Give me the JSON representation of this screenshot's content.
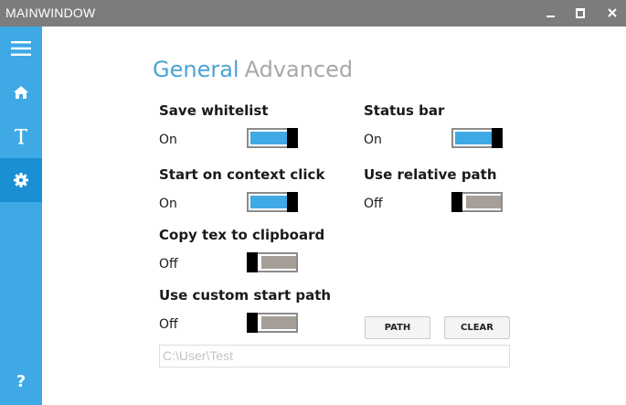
{
  "window": {
    "title": "MAINWINDOW"
  },
  "sidebar": {
    "items": [
      {
        "icon": "menu-icon"
      },
      {
        "icon": "home-icon"
      },
      {
        "icon": "text-icon",
        "glyph": "T"
      },
      {
        "icon": "gear-icon",
        "active": true
      },
      {
        "icon": "help-icon",
        "glyph": "?"
      }
    ]
  },
  "tabs": {
    "general": "General",
    "advanced": "Advanced",
    "active": "General"
  },
  "settings": {
    "save_whitelist": {
      "label": "Save whitelist",
      "state": "On"
    },
    "status_bar": {
      "label": "Status bar",
      "state": "On"
    },
    "start_on_context_click": {
      "label": "Start on context click",
      "state": "On"
    },
    "use_relative_path": {
      "label": "Use relative path",
      "state": "Off"
    },
    "copy_tex_to_clipboard": {
      "label": "Copy tex to clipboard",
      "state": "Off"
    },
    "use_custom_start_path": {
      "label": "Use custom start path",
      "state": "Off"
    }
  },
  "buttons": {
    "path": "PATH",
    "clear": "CLEAR"
  },
  "path_input": {
    "value": "C:\\User\\Test"
  },
  "colors": {
    "accent": "#3fa9e5",
    "accent_active": "#1b8fd4",
    "titlebar": "#7c7c7c",
    "toggle_off": "#a59f98"
  }
}
